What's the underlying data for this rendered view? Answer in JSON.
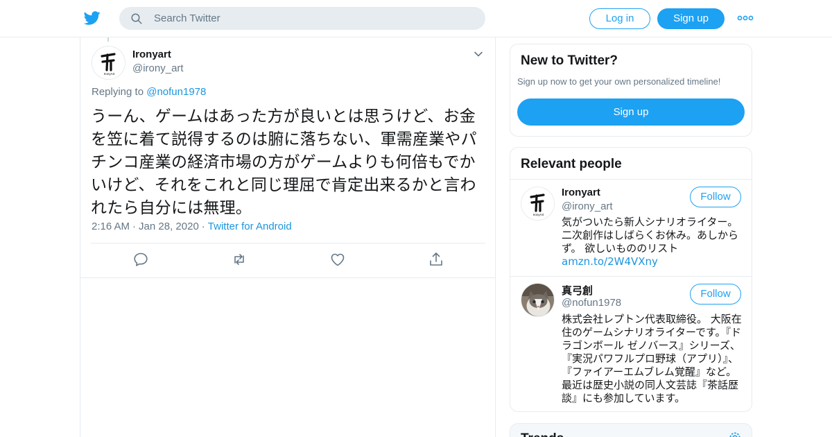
{
  "header": {
    "search_placeholder": "Search Twitter",
    "login_label": "Log in",
    "signup_label": "Sign up",
    "icons": {
      "logo": "twitter-bird-icon",
      "search": "search-icon",
      "more": "more-horizontal-icon"
    }
  },
  "tweet": {
    "author_name": "Ironyart",
    "author_handle": "@irony_art",
    "replying_prefix": "Replying to ",
    "replying_to": "@nofun1978",
    "text": "うーん、ゲームはあった方が良いとは思うけど、お金を笠に着て説得するのは腑に落ちない、軍需産業やパチンコ産業の経済市場の方がゲームよりも何倍もでかいけど、それをこれと同じ理屈で肯定出来るかと言われたら自分には無理。",
    "time": "2:16 AM",
    "date": "Jan 28, 2020",
    "source": "Twitter for Android",
    "icons": {
      "reply": "reply-icon",
      "retweet": "retweet-icon",
      "like": "heart-icon",
      "share": "share-icon",
      "caret": "chevron-down-icon"
    }
  },
  "sidebar": {
    "new_to_twitter": {
      "title": "New to Twitter?",
      "subtitle": "Sign up now to get your own personalized timeline!",
      "signup_label": "Sign up"
    },
    "relevant_people": {
      "title": "Relevant people",
      "people": [
        {
          "name": "Ironyart",
          "handle": "@irony_art",
          "follow_label": "Follow",
          "bio": "気がついたら新人シナリオライター。二次創作はしばらくお休み。あしからず。 欲しいもののリスト",
          "bio_link": "amzn.to/2W4VXny"
        },
        {
          "name": "真弓創",
          "handle": "@nofun1978",
          "follow_label": "Follow",
          "bio": "株式会社レプトン代表取締役。 大阪在住のゲームシナリオライターです。『ドラゴンボール ゼノバース』シリーズ、『実況パワフルプロ野球（アプリ）』、『ファイアーエムブレム覚醒』など。最近は歴史小説の同人文芸誌『茶話歴談』にも参加しています。"
        }
      ]
    },
    "trends": {
      "title": "Trends",
      "gear_icon": "gear-icon"
    }
  },
  "colors": {
    "brand": "#1da1f2",
    "link": "#1b95e0",
    "secondary_text": "#657786",
    "border": "#e6ecf0"
  }
}
